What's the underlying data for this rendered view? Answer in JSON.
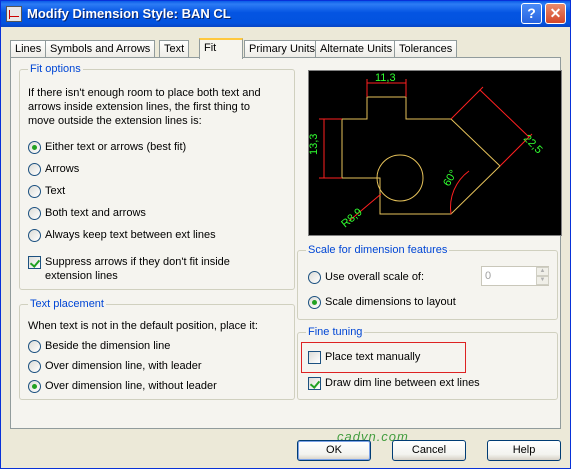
{
  "window": {
    "title": "Modify Dimension Style: BAN CL"
  },
  "titlebar_buttons": {
    "help": "?",
    "close": "✕"
  },
  "tabs": [
    {
      "label": "Lines"
    },
    {
      "label": "Symbols and Arrows"
    },
    {
      "label": "Text"
    },
    {
      "label": "Fit",
      "active": true
    },
    {
      "label": "Primary Units"
    },
    {
      "label": "Alternate Units"
    },
    {
      "label": "Tolerances"
    }
  ],
  "fit_options": {
    "title": "Fit options",
    "description": [
      "If there isn't enough room to place both text and",
      "arrows inside extension lines, the first thing to",
      "move outside the extension lines is:"
    ],
    "options": [
      {
        "label": "Either text or arrows (best fit)",
        "checked": true
      },
      {
        "label": "Arrows",
        "checked": false
      },
      {
        "label": "Text",
        "checked": false
      },
      {
        "label": "Both text and arrows",
        "checked": false
      },
      {
        "label": "Always keep text between ext lines",
        "checked": false
      }
    ],
    "suppress": {
      "line1": "Suppress arrows if they don't fit inside",
      "line2": "extension lines",
      "checked": true
    }
  },
  "text_placement": {
    "title": "Text placement",
    "description": "When text is not in the default position, place it:",
    "options": [
      {
        "label": "Beside the dimension line",
        "checked": false
      },
      {
        "label": "Over dimension line, with leader",
        "checked": false
      },
      {
        "label": "Over dimension line, without leader",
        "checked": true
      }
    ]
  },
  "preview": {
    "labels": {
      "top": "11,3",
      "left": "13,3",
      "diag": "22,5",
      "angle": "60°",
      "radius": "R8,9"
    },
    "colors": {
      "background": "#000000",
      "geometry": "#e6c25a",
      "dimension": "#ff2020",
      "text": "#30ff30"
    }
  },
  "scale": {
    "title": "Scale for dimension features",
    "overall_label": "Use overall scale of:",
    "overall_checked": false,
    "overall_value": "0",
    "layout_label": "Scale dimensions to layout",
    "layout_checked": true
  },
  "fine_tuning": {
    "title": "Fine tuning",
    "place_manually": {
      "label": "Place text manually",
      "checked": false
    },
    "draw_dim_line": {
      "label": "Draw dim line between ext lines",
      "checked": true
    }
  },
  "watermark": "cadvn.com",
  "buttons": {
    "ok": "OK",
    "cancel": "Cancel",
    "help": "Help"
  },
  "colors": {
    "accent": "#0046d5",
    "highlight": "#d22222",
    "radio_dot": "#21a121"
  }
}
